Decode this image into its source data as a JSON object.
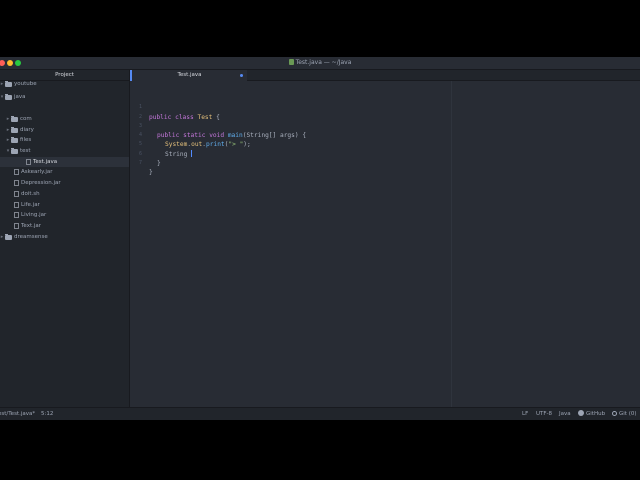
{
  "window": {
    "title": "Test.java — ~/Java"
  },
  "sidebar": {
    "header": "Project",
    "tree": [
      {
        "name": "youtube",
        "type": "folder",
        "expanded": false,
        "depth": 0
      },
      {
        "name": "java",
        "type": "folder",
        "expanded": true,
        "depth": 0
      },
      {
        "name": "com",
        "type": "folder",
        "expanded": false,
        "depth": 1
      },
      {
        "name": "diary",
        "type": "folder",
        "expanded": false,
        "depth": 1
      },
      {
        "name": "files",
        "type": "folder",
        "expanded": false,
        "depth": 1
      },
      {
        "name": "test",
        "type": "folder",
        "expanded": true,
        "depth": 1
      },
      {
        "name": "Test.java",
        "type": "file",
        "depth": 2,
        "selected": true
      },
      {
        "name": "Askearly.jar",
        "type": "file",
        "depth": 1
      },
      {
        "name": "Depression.jar",
        "type": "file",
        "depth": 1
      },
      {
        "name": "doit.sh",
        "type": "file",
        "depth": 1
      },
      {
        "name": "Life.jar",
        "type": "file",
        "depth": 1
      },
      {
        "name": "Living.jar",
        "type": "file",
        "depth": 1
      },
      {
        "name": "Text.jar",
        "type": "file",
        "depth": 1
      },
      {
        "name": "dreamsense",
        "type": "folder",
        "expanded": false,
        "depth": 0
      }
    ]
  },
  "editor": {
    "tab_title": "Test.java",
    "modified": true,
    "line_numbers": [
      "1",
      "2",
      "3",
      "4",
      "5",
      "6",
      "7"
    ],
    "code": {
      "l1": {
        "kw1": "public",
        "kw2": "class",
        "cls": "Test",
        "brace": "{"
      },
      "l3": {
        "kw1": "public",
        "kw2": "static",
        "kw3": "void",
        "fn": "main",
        "params": "(String[] args) {"
      },
      "l4": {
        "obj": "System",
        "dot1": ".",
        "field": "out",
        "dot2": ".",
        "fn": "print",
        "open": "(",
        "str": "\"> \"",
        "close": ");"
      },
      "l5": {
        "type": "String",
        "rest": " "
      },
      "l6": {
        "brace": "}"
      },
      "l7": {
        "brace": "}"
      }
    }
  },
  "statusbar": {
    "path": "est/Test.java*",
    "cursor_pos": "5:12",
    "line_ending": "LF",
    "encoding": "UTF-8",
    "grammar": "Java",
    "github": "GitHub",
    "git": "Git (0)"
  },
  "colors": {
    "accent": "#568af2",
    "keyword": "#c678dd",
    "class": "#e5c07b",
    "function": "#61afef",
    "string": "#98c379",
    "background": "#282c34",
    "panel": "#21252b"
  }
}
